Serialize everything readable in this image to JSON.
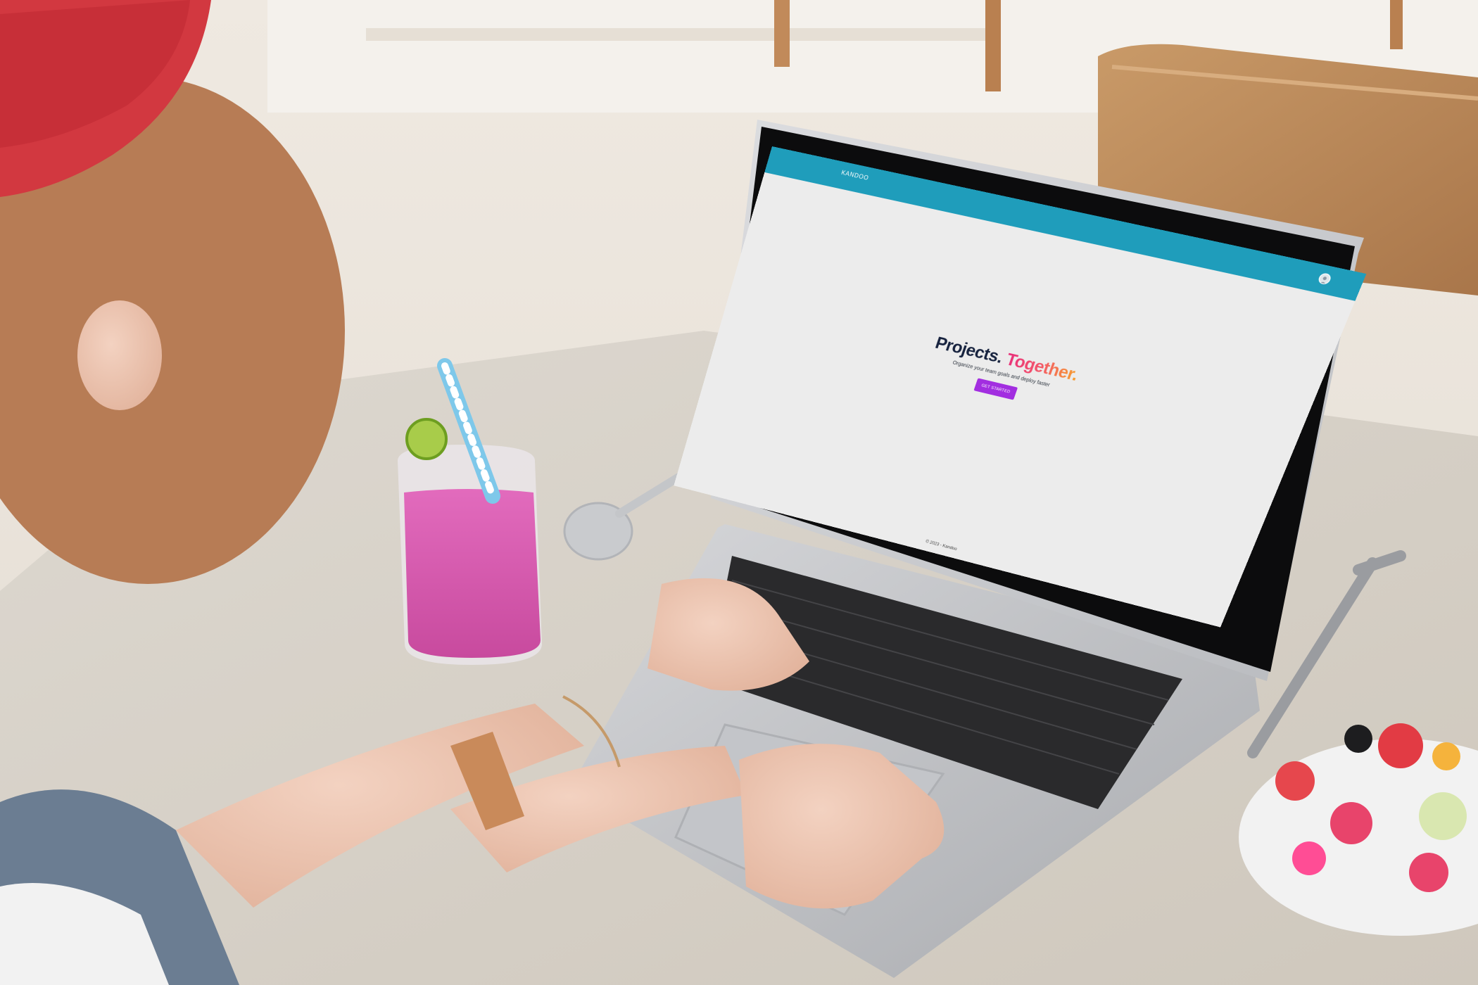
{
  "app": {
    "brand": "KANDOO",
    "header_color": "#1f9dbb",
    "avatar_icon": "user-avatar-icon"
  },
  "hero": {
    "title_part_1": "Projects.",
    "title_part_2": "Together.",
    "subtitle": "Organize your team goals and deploy faster",
    "cta_label": "GET STARTED",
    "cta_color": "#a22ee0"
  },
  "footer": {
    "text": "© 2023 - Kandoo"
  },
  "colors": {
    "page_background": "#ececec",
    "title_dark": "#16223e",
    "title_gradient_start": "#e8307a",
    "title_gradient_end": "#f79f2c"
  }
}
